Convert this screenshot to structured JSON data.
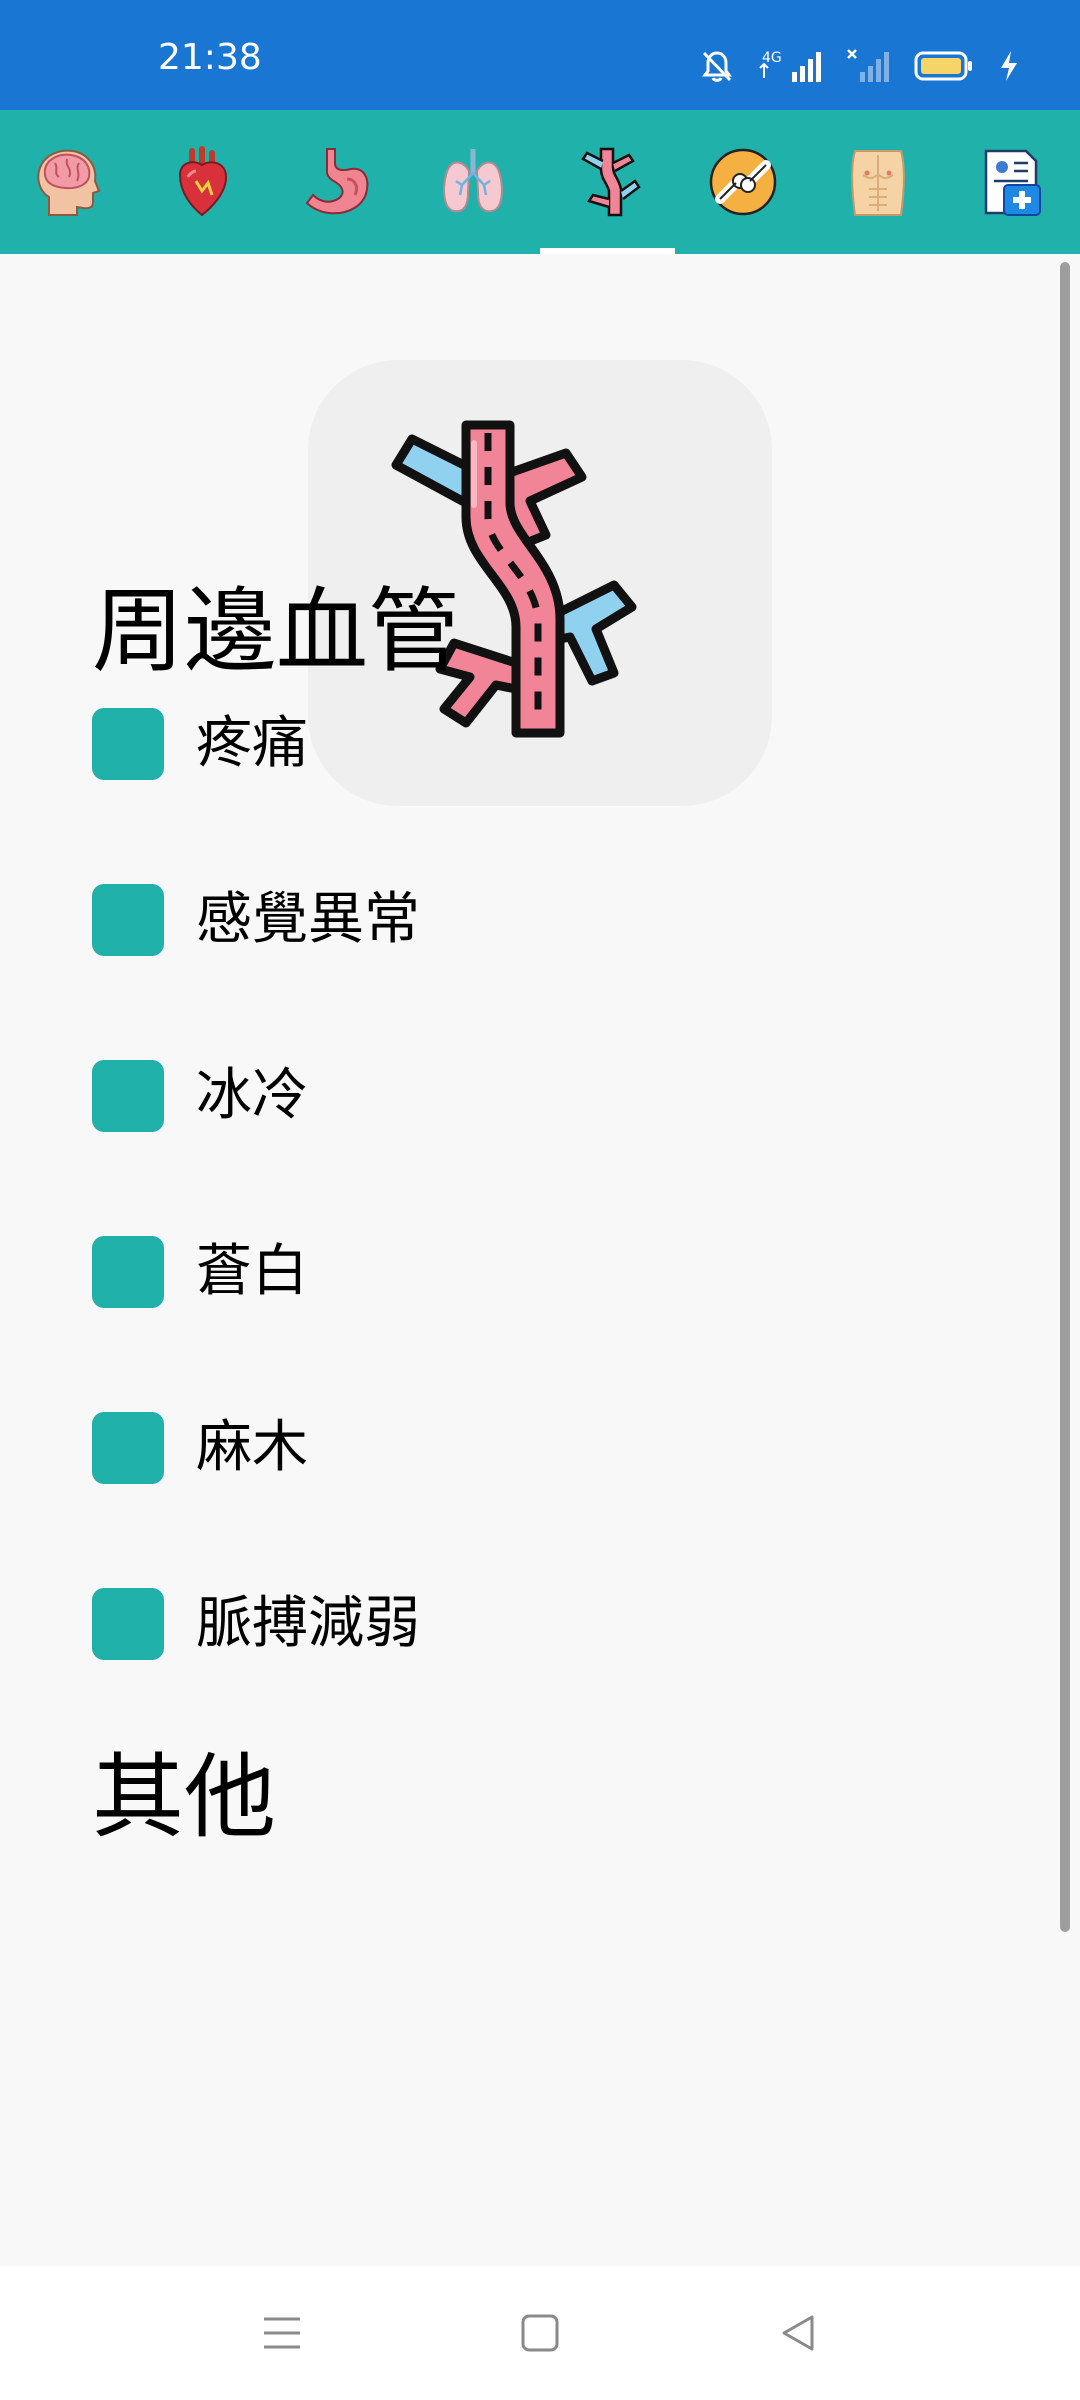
{
  "status_bar": {
    "time": "21:38",
    "icons": [
      "bell-off-icon",
      "signal-4g-icon",
      "signal-icon",
      "battery-icon",
      "charging-icon"
    ],
    "network_label": "4G"
  },
  "tabs": [
    {
      "name": "brain",
      "icon": "head-brain-icon"
    },
    {
      "name": "heart",
      "icon": "heart-icon"
    },
    {
      "name": "stomach",
      "icon": "stomach-icon"
    },
    {
      "name": "lungs",
      "icon": "lungs-icon"
    },
    {
      "name": "blood-vessels",
      "icon": "blood-vessel-icon",
      "selected": true
    },
    {
      "name": "joint",
      "icon": "joint-icon"
    },
    {
      "name": "torso",
      "icon": "torso-icon"
    },
    {
      "name": "medical-record",
      "icon": "medical-record-icon"
    }
  ],
  "hero": {
    "icon": "blood-vessel-icon"
  },
  "sections": [
    {
      "title": "周邊血管",
      "items": [
        {
          "label": "疼痛",
          "checked": false
        },
        {
          "label": "感覺異常",
          "checked": false
        },
        {
          "label": "冰冷",
          "checked": false
        },
        {
          "label": "蒼白",
          "checked": false
        },
        {
          "label": "麻木",
          "checked": false
        },
        {
          "label": "脈搏減弱",
          "checked": false
        }
      ]
    },
    {
      "title": "其他",
      "items": []
    }
  ],
  "colors": {
    "status_bar": "#1976d2",
    "accent": "#20b1aa",
    "background": "#f8f8f8"
  },
  "nav_bar": {
    "icons": [
      "menu-icon",
      "home-icon",
      "back-icon"
    ]
  }
}
